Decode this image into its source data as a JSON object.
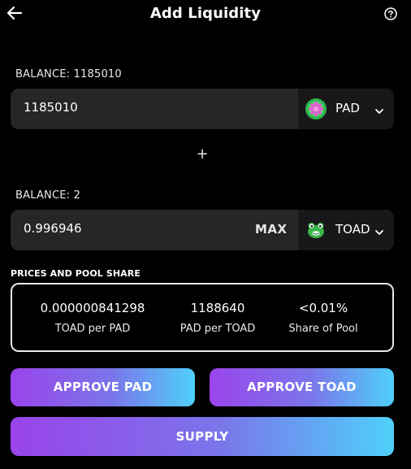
{
  "header": {
    "title": "Add Liquidity",
    "back_icon": "arrow-left-icon",
    "help_icon": "question-circle-icon"
  },
  "input_a": {
    "balance_label": "BALANCE: 1185010",
    "amount": "1185010",
    "token": "PAD",
    "token_icon": "pad-token-icon"
  },
  "plus_symbol": "+",
  "input_b": {
    "balance_label": "BALANCE: 2",
    "amount": "0.996946",
    "max_label": "MAX",
    "token": "TOAD",
    "token_icon": "toad-token-icon"
  },
  "pool": {
    "section_label": "PRICES AND POOL SHARE",
    "items": [
      {
        "value": "0.000000841298",
        "caption": "TOAD per PAD"
      },
      {
        "value": "1188640",
        "caption": "PAD per TOAD"
      },
      {
        "value": "<0.01%",
        "caption": "Share of Pool"
      }
    ]
  },
  "actions": {
    "approve_a": "APPROVE PAD",
    "approve_b": "APPROVE TOAD",
    "supply": "SUPPLY"
  },
  "colors": {
    "background": "#000000",
    "field": "#262629",
    "token_selector": "#18181a",
    "gradient_start": "#9a44ea",
    "gradient_end": "#4fd0fa"
  }
}
